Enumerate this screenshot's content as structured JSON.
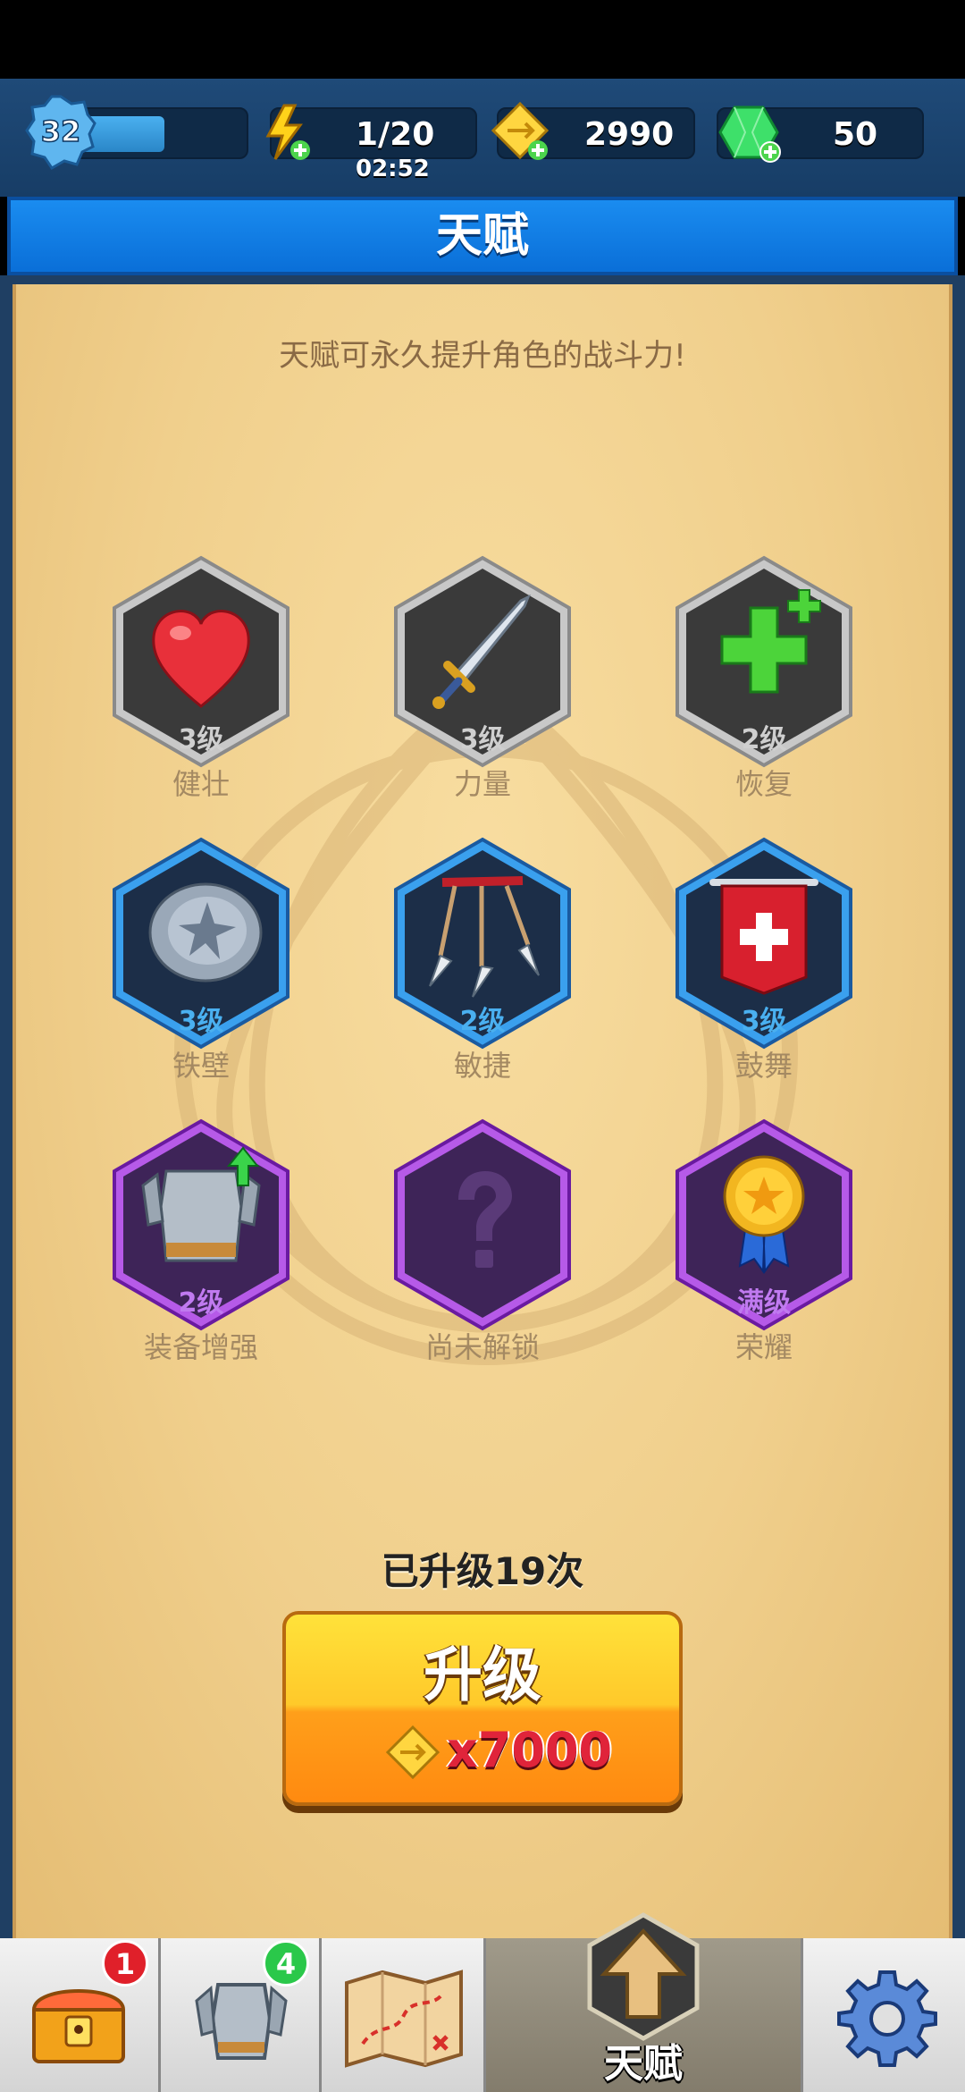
{
  "top_bar": {
    "player_level": "32",
    "xp_progress": 0.55,
    "energy": "1/20",
    "energy_timer": "02:52",
    "gold": "2990",
    "gems": "50"
  },
  "header": {
    "title": "天赋"
  },
  "panel": {
    "subtitle": "天赋可永久提升角色的战斗力!",
    "talents": [
      {
        "name": "健壮",
        "level": "3级",
        "tier": "gray",
        "icon": "heart-icon"
      },
      {
        "name": "力量",
        "level": "3级",
        "tier": "gray",
        "icon": "sword-icon"
      },
      {
        "name": "恢复",
        "level": "2级",
        "tier": "gray",
        "icon": "green-cross-icon"
      },
      {
        "name": "铁壁",
        "level": "3级",
        "tier": "blue",
        "icon": "spiked-shield-icon"
      },
      {
        "name": "敏捷",
        "level": "2级",
        "tier": "blue",
        "icon": "arrows-icon"
      },
      {
        "name": "鼓舞",
        "level": "3级",
        "tier": "blue",
        "icon": "banner-icon"
      },
      {
        "name": "装备增强",
        "level": "2级",
        "tier": "purple",
        "icon": "armor-upgrade-icon"
      },
      {
        "name": "尚未解锁",
        "level": "",
        "tier": "purple",
        "icon": "question-mark-icon"
      },
      {
        "name": "荣耀",
        "level": "满级",
        "tier": "purple",
        "icon": "medal-icon"
      }
    ],
    "upgrade_count": "已升级19次",
    "upgrade_button": {
      "label": "升级",
      "cost": "x7000"
    }
  },
  "bottom_nav": {
    "chest_badge": "1",
    "equipment_badge": "4",
    "active_tab_label": "天赋"
  }
}
